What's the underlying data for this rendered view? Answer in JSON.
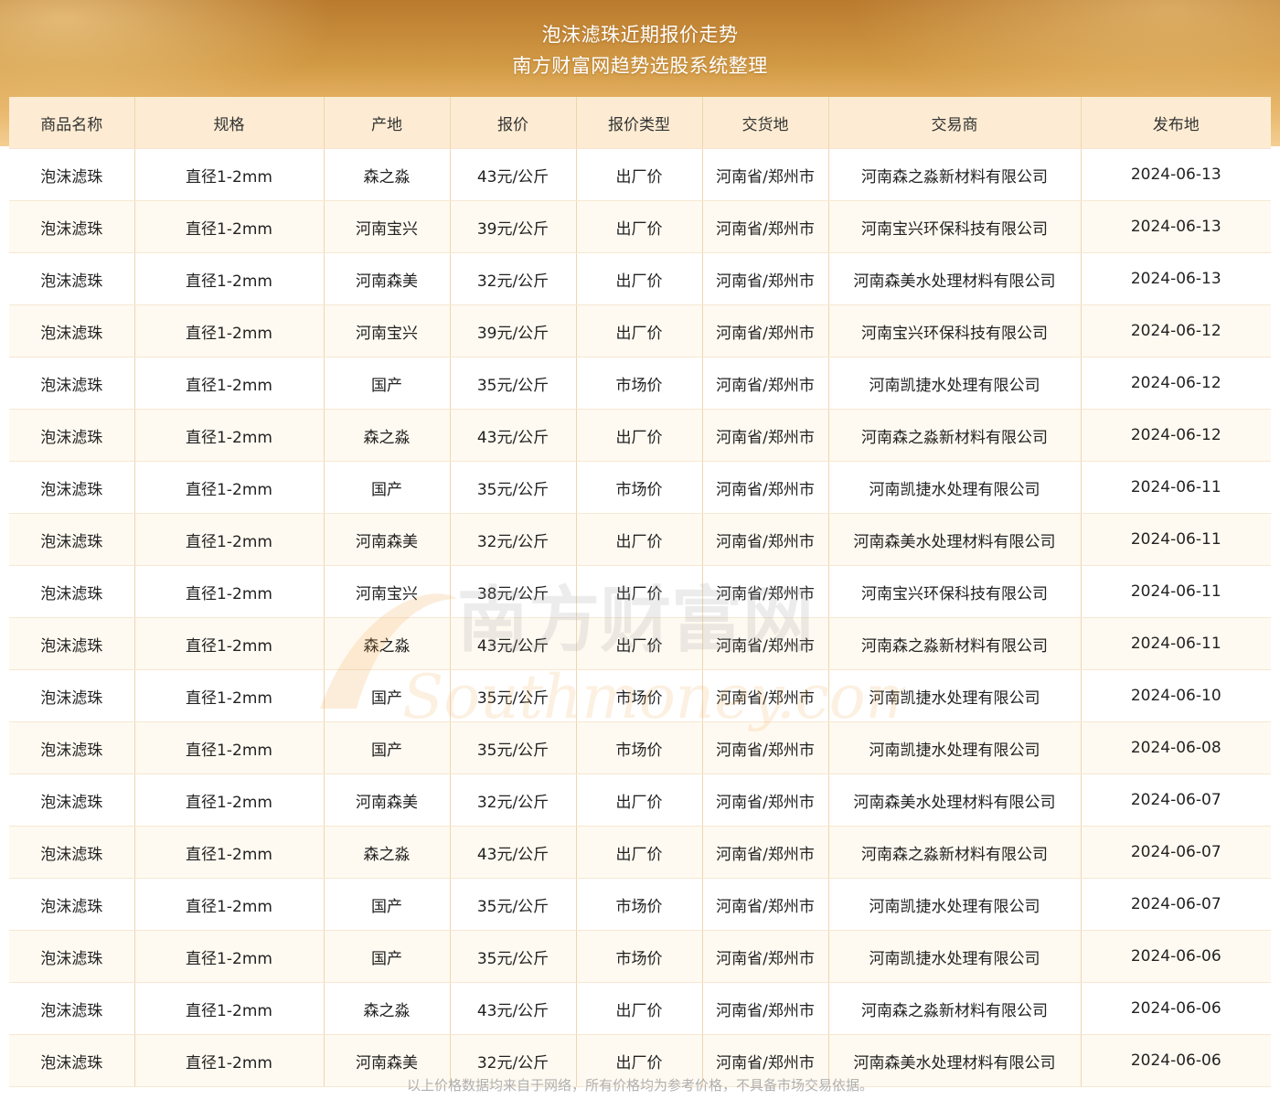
{
  "header": {
    "title": "泡沫滤珠近期报价走势",
    "subtitle": "南方财富网趋势选股系统整理"
  },
  "table": {
    "columns": [
      "商品名称",
      "规格",
      "产地",
      "报价",
      "报价类型",
      "交货地",
      "交易商",
      "发布地"
    ],
    "rows": [
      [
        "泡沫滤珠",
        "直径1-2mm",
        "森之淼",
        "43元/公斤",
        "出厂价",
        "河南省/郑州市",
        "河南森之淼新材料有限公司",
        "2024-06-13"
      ],
      [
        "泡沫滤珠",
        "直径1-2mm",
        "河南宝兴",
        "39元/公斤",
        "出厂价",
        "河南省/郑州市",
        "河南宝兴环保科技有限公司",
        "2024-06-13"
      ],
      [
        "泡沫滤珠",
        "直径1-2mm",
        "河南森美",
        "32元/公斤",
        "出厂价",
        "河南省/郑州市",
        "河南森美水处理材料有限公司",
        "2024-06-13"
      ],
      [
        "泡沫滤珠",
        "直径1-2mm",
        "河南宝兴",
        "39元/公斤",
        "出厂价",
        "河南省/郑州市",
        "河南宝兴环保科技有限公司",
        "2024-06-12"
      ],
      [
        "泡沫滤珠",
        "直径1-2mm",
        "国产",
        "35元/公斤",
        "市场价",
        "河南省/郑州市",
        "河南凯捷水处理有限公司",
        "2024-06-12"
      ],
      [
        "泡沫滤珠",
        "直径1-2mm",
        "森之淼",
        "43元/公斤",
        "出厂价",
        "河南省/郑州市",
        "河南森之淼新材料有限公司",
        "2024-06-12"
      ],
      [
        "泡沫滤珠",
        "直径1-2mm",
        "国产",
        "35元/公斤",
        "市场价",
        "河南省/郑州市",
        "河南凯捷水处理有限公司",
        "2024-06-11"
      ],
      [
        "泡沫滤珠",
        "直径1-2mm",
        "河南森美",
        "32元/公斤",
        "出厂价",
        "河南省/郑州市",
        "河南森美水处理材料有限公司",
        "2024-06-11"
      ],
      [
        "泡沫滤珠",
        "直径1-2mm",
        "河南宝兴",
        "38元/公斤",
        "出厂价",
        "河南省/郑州市",
        "河南宝兴环保科技有限公司",
        "2024-06-11"
      ],
      [
        "泡沫滤珠",
        "直径1-2mm",
        "森之淼",
        "43元/公斤",
        "出厂价",
        "河南省/郑州市",
        "河南森之淼新材料有限公司",
        "2024-06-11"
      ],
      [
        "泡沫滤珠",
        "直径1-2mm",
        "国产",
        "35元/公斤",
        "市场价",
        "河南省/郑州市",
        "河南凯捷水处理有限公司",
        "2024-06-10"
      ],
      [
        "泡沫滤珠",
        "直径1-2mm",
        "国产",
        "35元/公斤",
        "市场价",
        "河南省/郑州市",
        "河南凯捷水处理有限公司",
        "2024-06-08"
      ],
      [
        "泡沫滤珠",
        "直径1-2mm",
        "河南森美",
        "32元/公斤",
        "出厂价",
        "河南省/郑州市",
        "河南森美水处理材料有限公司",
        "2024-06-07"
      ],
      [
        "泡沫滤珠",
        "直径1-2mm",
        "森之淼",
        "43元/公斤",
        "出厂价",
        "河南省/郑州市",
        "河南森之淼新材料有限公司",
        "2024-06-07"
      ],
      [
        "泡沫滤珠",
        "直径1-2mm",
        "国产",
        "35元/公斤",
        "市场价",
        "河南省/郑州市",
        "河南凯捷水处理有限公司",
        "2024-06-07"
      ],
      [
        "泡沫滤珠",
        "直径1-2mm",
        "国产",
        "35元/公斤",
        "市场价",
        "河南省/郑州市",
        "河南凯捷水处理有限公司",
        "2024-06-06"
      ],
      [
        "泡沫滤珠",
        "直径1-2mm",
        "森之淼",
        "43元/公斤",
        "出厂价",
        "河南省/郑州市",
        "河南森之淼新材料有限公司",
        "2024-06-06"
      ],
      [
        "泡沫滤珠",
        "直径1-2mm",
        "河南森美",
        "32元/公斤",
        "出厂价",
        "河南省/郑州市",
        "河南森美水处理材料有限公司",
        "2024-06-06"
      ]
    ]
  },
  "watermark": {
    "cn": "南方财富网",
    "en": "Southmoney.com"
  },
  "footnote": "以上价格数据均来自于网络，所有价格均为参考价格，不具备市场交易依据。",
  "colors": {
    "header_row": "#fdecd3",
    "border": "#efd5b0",
    "alt_row": "#fffaf1"
  }
}
